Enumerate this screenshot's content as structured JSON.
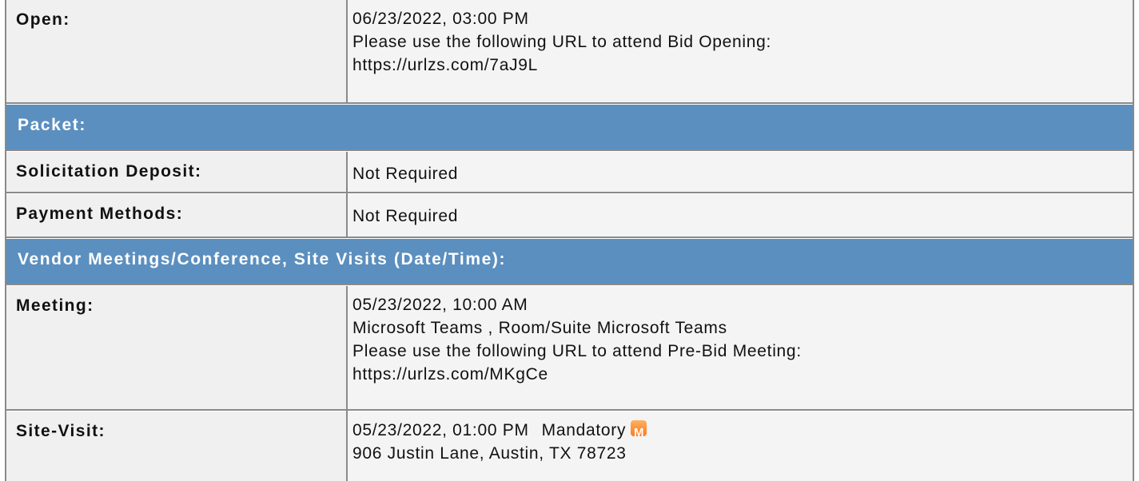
{
  "open": {
    "label": "Open:",
    "date_time": "06/23/2022, 03:00 PM",
    "note": "Please use the following URL to attend Bid Opening:",
    "url": "https://urlzs.com/7aJ9L"
  },
  "packet": {
    "header": "Packet:",
    "solicitation_deposit_label": "Solicitation Deposit:",
    "solicitation_deposit_value": "Not Required",
    "payment_methods_label": "Payment Methods:",
    "payment_methods_value": "Not Required"
  },
  "vendor_meetings": {
    "header": "Vendor Meetings/Conference, Site Visits (Date/Time):",
    "meeting": {
      "label": "Meeting:",
      "date_time": "05/23/2022, 10:00 AM",
      "location": "Microsoft Teams , Room/Suite Microsoft Teams",
      "note": "Please use the following URL to attend Pre-Bid Meeting:",
      "url": "https://urlzs.com/MKgCe"
    },
    "site_visit": {
      "label": "Site-Visit:",
      "date_time": "05/23/2022, 01:00 PM",
      "status": "Mandatory",
      "status_icon": "mandatory-icon",
      "status_icon_letter": "M",
      "address": "906 Justin Lane, Austin, TX 78723"
    }
  },
  "colors": {
    "section_header_bg": "#5b8fbf",
    "label_bg": "#f0f0f0",
    "value_bg": "#f4f4f4",
    "mandatory_icon": "#ff8a2a"
  }
}
